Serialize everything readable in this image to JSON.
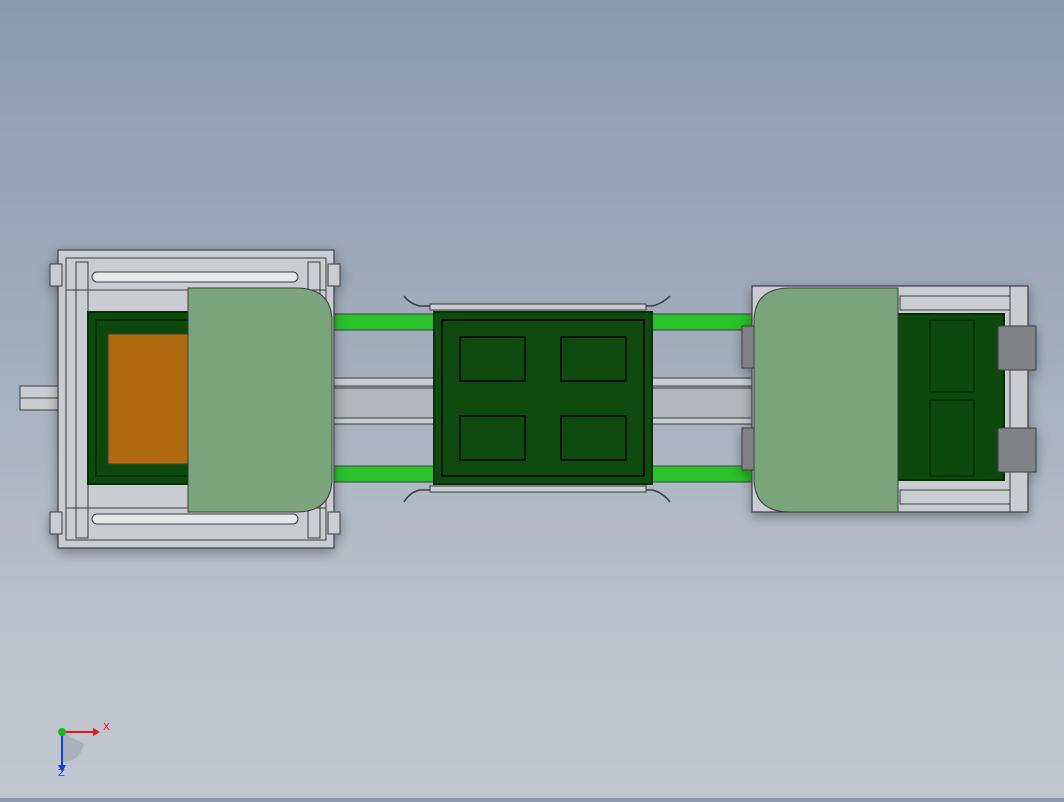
{
  "view": {
    "background_top": "#8c9aae",
    "background_bottom": "#c2c8d0"
  },
  "model": {
    "colors": {
      "frame": "#c9ccd0",
      "frame_line": "#3a3d40",
      "dark_green": "#0f4a0f",
      "darker_green": "#063306",
      "bright_green": "#29c229",
      "cover": "#7aa57a",
      "orange": "#b06a0a",
      "gray_block": "#808285"
    }
  },
  "triad": {
    "x_label": "X",
    "z_label": "Z",
    "x_color": "#e01818",
    "y_color": "#18b818",
    "z_color": "#1840d8"
  }
}
